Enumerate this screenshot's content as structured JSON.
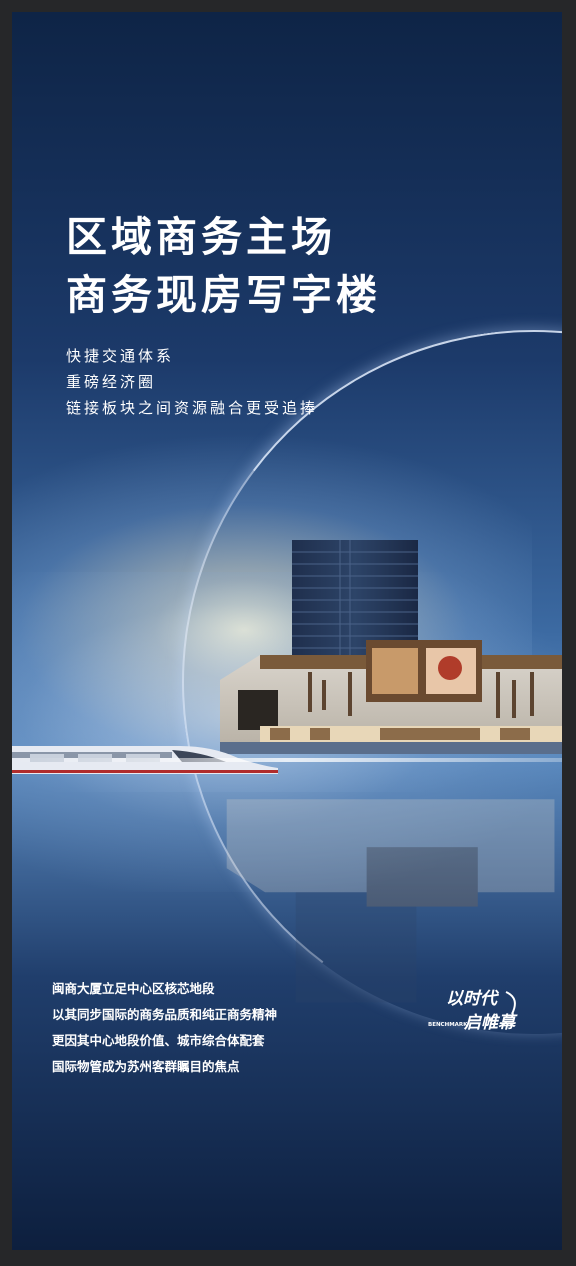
{
  "headline": {
    "line1": "区域商务主场",
    "line2": "商务现房写字楼"
  },
  "subheadings": [
    "快捷交通体系",
    "重磅经济圈",
    "链接板块之间资源融合更受追捧"
  ],
  "body_lines": [
    "闽商大厦立足中心区核芯地段",
    "以其同步国际的商务品质和纯正商务精神",
    "更因其中心地段价值、城市综合体配套",
    "国际物管成为苏州客群瞩目的焦点"
  ],
  "logo": {
    "line1": "以时代",
    "line2": "启帷幕",
    "sub": "BENCHMARK"
  },
  "colors": {
    "frame": "#262729",
    "deep_blue": "#0e2446",
    "light_blue": "#5c8bc0",
    "glow": "#fff8d6"
  }
}
